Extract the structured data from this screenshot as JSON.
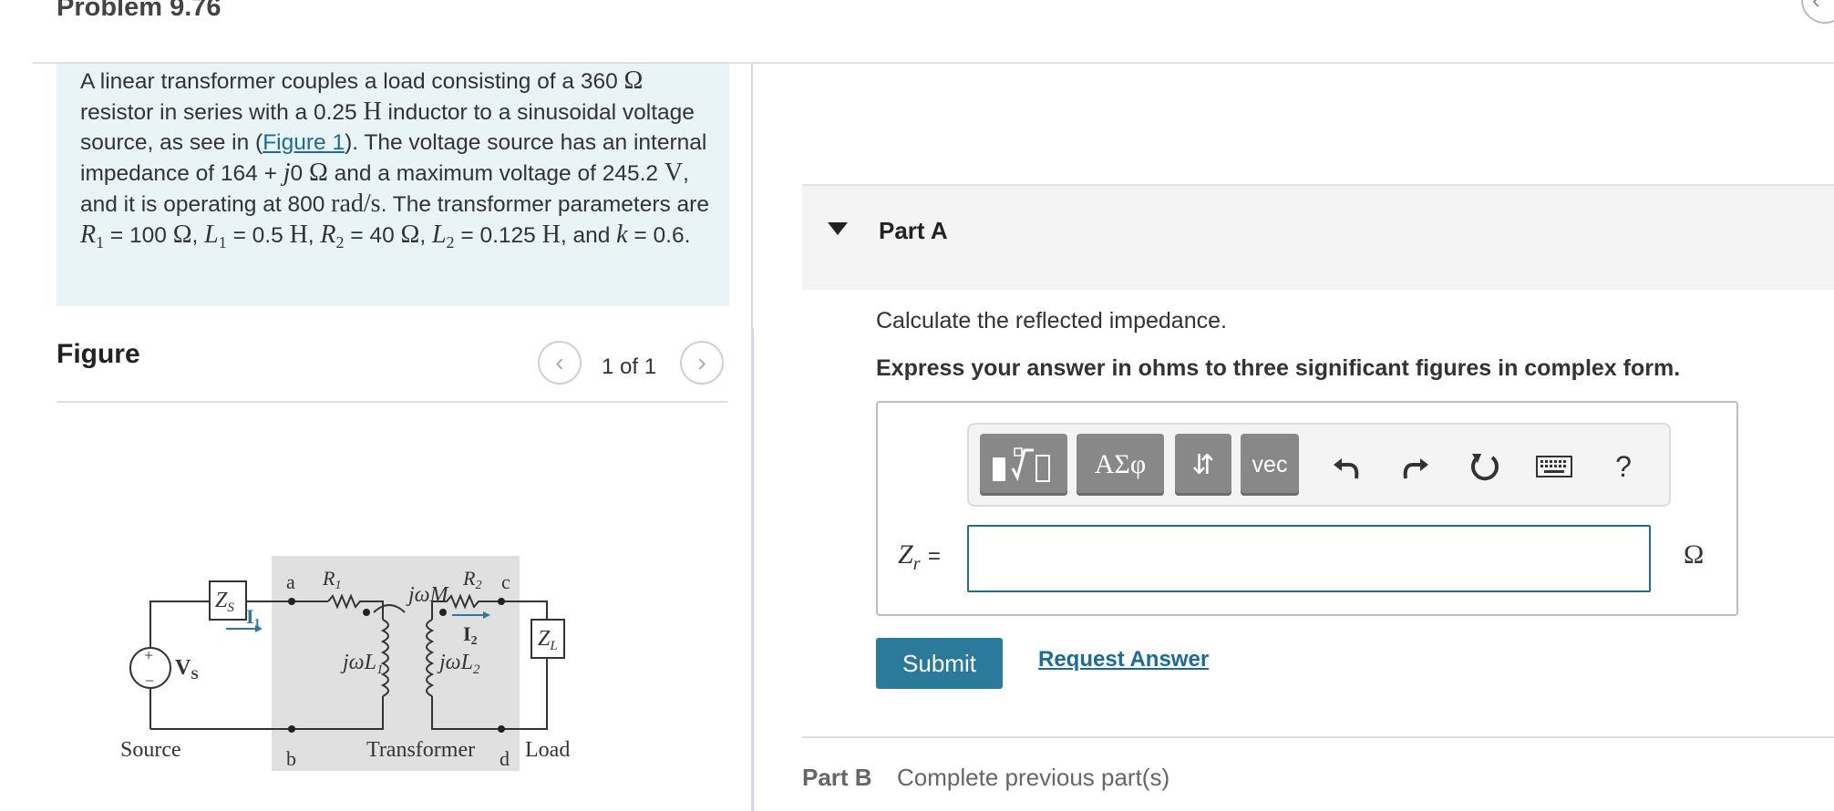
{
  "header": {
    "title": "Problem 9.76",
    "collapse_icon": "chevron-left-icon"
  },
  "problem": {
    "s1": "A linear transformer couples a load consisting of a 360",
    "ohm": "Ω",
    "s2": "resistor in series with a 0.25",
    "henry": "H",
    "s3": "inductor to a sinusoidal voltage source, as see in (",
    "figure_link": "Figure 1",
    "s4": "). The voltage source has an internal impedance of 164 +",
    "j0": "j",
    "zero": "0",
    "s5": "and a maximum voltage of 245.2",
    "volt": "V",
    "s6": ", and it is operating at 800",
    "rads": "rad/s",
    "s7": ". The transformer parameters are",
    "R1": "R",
    "sub1": "1",
    "eq100": "= 100",
    "L1": "L",
    "eq05": "= 0.5",
    "R2": "R",
    "sub2": "2",
    "eq40": "= 40",
    "L2": "L",
    "eq0125": "= 0.125",
    "and_k": ", and",
    "k": "k",
    "eq06": "= 0.6."
  },
  "figure": {
    "title": "Figure",
    "pager": "1 of 1",
    "circuit": {
      "zs": "Z",
      "zs_sub": "S",
      "vs": "V",
      "vs_sub": "S",
      "i1": "I",
      "i1_sub": "1",
      "i2": "I",
      "i2_sub": "2",
      "a": "a",
      "b": "b",
      "c": "c",
      "d": "d",
      "r1": "R",
      "r1_sub": "1",
      "r2": "R",
      "r2_sub": "2",
      "jwm": "jωM",
      "jwl1": "jωL",
      "jwl1_sub": "1",
      "jwl2": "jωL",
      "jwl2_sub": "2",
      "zl": "Z",
      "zl_sub": "L",
      "plus": "+",
      "minus": "−",
      "source": "Source",
      "transformer": "Transformer",
      "load": "Load"
    }
  },
  "partA": {
    "label": "Part A",
    "question": "Calculate the reflected impedance.",
    "instruction": "Express your answer in ohms to three significant figures in complex form.",
    "toolbar": {
      "greek": "ΑΣφ",
      "arrows": "⇵",
      "vec": "vec",
      "help": "?",
      "icons": [
        "templates-icon",
        "undo-icon",
        "redo-icon",
        "reset-icon",
        "keyboard-icon"
      ]
    },
    "var_label": "Z",
    "var_sub": "r",
    "equals": "=",
    "input_value": "",
    "unit": "Ω",
    "submit": "Submit",
    "request": "Request Answer"
  },
  "partB": {
    "label": "Part B",
    "status": "Complete previous part(s)"
  },
  "colors": {
    "accent": "#2b7a9c",
    "link": "#1a6b9c",
    "problem_bg": "#e8f4f5",
    "toolbar_btn": "#888888"
  }
}
